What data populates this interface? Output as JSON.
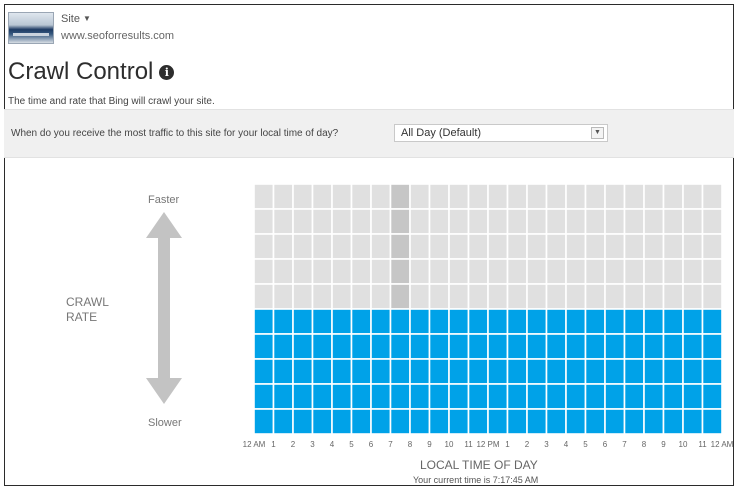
{
  "header": {
    "site_label": "Site",
    "site_url": "www.seoforresults.com",
    "thumbnail_icon": "site-thumbnail"
  },
  "page": {
    "title": "Crawl Control",
    "info_icon": "info-icon",
    "description": "The time and rate that Bing will crawl your site."
  },
  "question": {
    "text": "When do you receive the most traffic to this site for your local time of day?",
    "selected": "All Day (Default)"
  },
  "colors": {
    "active_blue": "#00a2e8",
    "inactive_gray": "#e0e0e0",
    "current_hour_gray": "#c6c6c6",
    "grid_line": "#ffffff"
  },
  "chart_data": {
    "type": "heatmap",
    "y_top_label": "Faster",
    "y_bottom_label": "Slower",
    "y_axis_label": [
      "CRAWL",
      "RATE"
    ],
    "xlabel": "LOCAL TIME OF DAY",
    "current_time": "Your current time is 7:17:45 AM",
    "levels": 10,
    "x_tick_labels": [
      "12 AM",
      "1",
      "2",
      "3",
      "4",
      "5",
      "6",
      "7",
      "8",
      "9",
      "10",
      "11",
      "12 PM",
      "1",
      "2",
      "3",
      "4",
      "5",
      "6",
      "7",
      "8",
      "9",
      "10",
      "11",
      "12 AM"
    ],
    "hours": [
      "12 AM",
      "1",
      "2",
      "3",
      "4",
      "5",
      "6",
      "7",
      "8",
      "9",
      "10",
      "11",
      "12 PM",
      "1",
      "2",
      "3",
      "4",
      "5",
      "6",
      "7",
      "8",
      "9",
      "10",
      "11"
    ],
    "rate_per_hour": [
      5,
      5,
      5,
      5,
      5,
      5,
      5,
      5,
      5,
      5,
      5,
      5,
      5,
      5,
      5,
      5,
      5,
      5,
      5,
      5,
      5,
      5,
      5,
      5
    ],
    "current_hour": "7"
  }
}
